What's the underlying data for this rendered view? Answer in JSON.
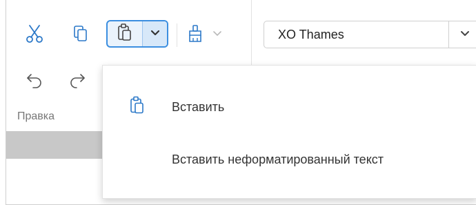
{
  "toolbar": {
    "group_label": "Правка",
    "font_name": "XO Thames"
  },
  "icons": {
    "cut": "scissors-icon",
    "copy": "copy-icon",
    "paste": "clipboard-icon",
    "format_painter": "paint-brush-icon",
    "undo": "undo-icon",
    "redo": "redo-icon",
    "dropdown": "chevron-down-icon"
  },
  "paste_menu": {
    "items": [
      {
        "label": "Вставить",
        "icon": "clipboard-icon"
      },
      {
        "label": "Вставить неформатированный текст"
      }
    ]
  },
  "colors": {
    "accent": "#3b8ee0",
    "icon": "#2b78c8",
    "disabled": "#b9b9b9"
  }
}
